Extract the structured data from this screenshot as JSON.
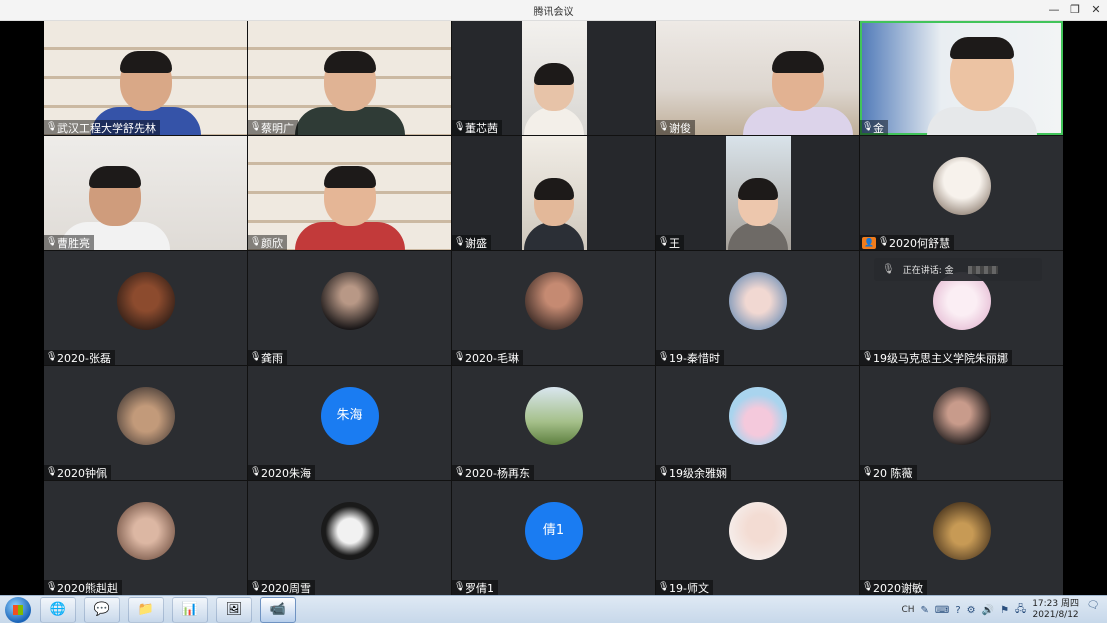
{
  "window": {
    "title": "腾讯会议",
    "minimize_glyph": "—",
    "restore_glyph": "❐",
    "close_glyph": "✕"
  },
  "participants": [
    {
      "name": "武汉工程大学舒先林"
    },
    {
      "name": "蔡明广"
    },
    {
      "name": "董芯茜"
    },
    {
      "name": "谢俊"
    },
    {
      "name": "金"
    },
    {
      "name": "曹胜亮"
    },
    {
      "name": "颜欣"
    },
    {
      "name": "谢盛"
    },
    {
      "name": "王"
    },
    {
      "name": "2020何舒慧"
    },
    {
      "name": "2020-张磊"
    },
    {
      "name": "龚雨"
    },
    {
      "name": "2020-毛琳"
    },
    {
      "name": "19-秦惜时"
    },
    {
      "name": "19级马克思主义学院朱丽娜"
    },
    {
      "name": "2020钟佩"
    },
    {
      "name": "2020朱海",
      "avatar_text": "朱海"
    },
    {
      "name": "2020-杨再东"
    },
    {
      "name": "19级余雅娴"
    },
    {
      "name": "20 陈薇"
    },
    {
      "name": "2020熊赳赳"
    },
    {
      "name": "2020周雪"
    },
    {
      "name": "罗倩1",
      "avatar_text": "倩1"
    },
    {
      "name": "19-师文"
    },
    {
      "name": "2020谢敏"
    }
  ],
  "speaking_indicator": {
    "label": "正在讲话: 金"
  },
  "taskbar": {
    "tray_lang": "CH",
    "clock_time": "17:23 周四",
    "clock_date": "2021/8/12"
  }
}
